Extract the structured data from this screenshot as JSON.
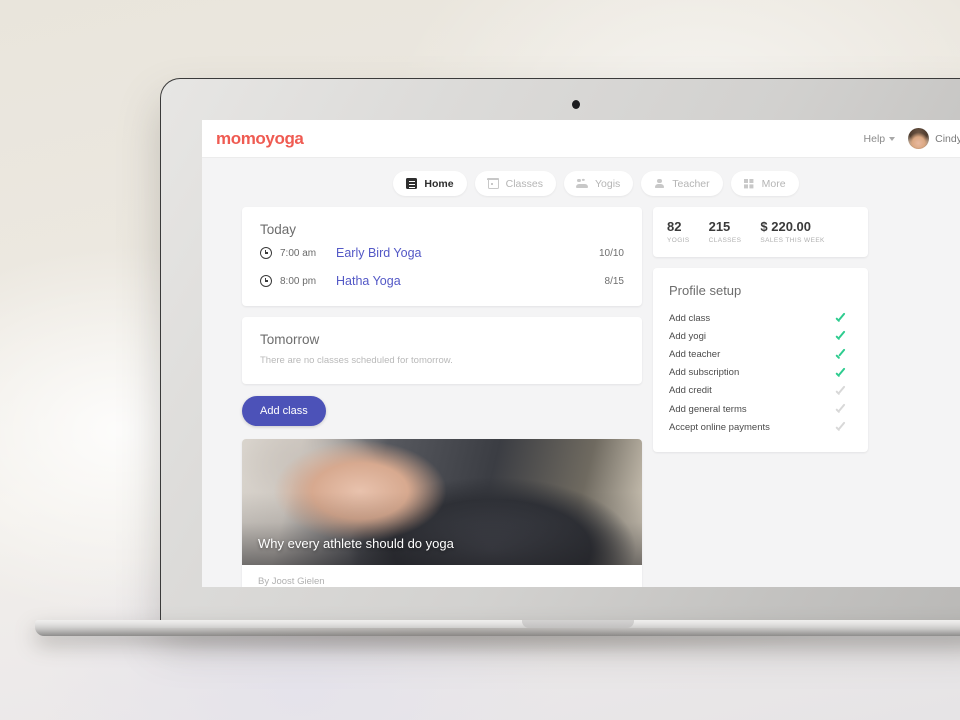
{
  "app": {
    "logo": "momoyoga",
    "help_label": "Help",
    "user_name": "Cindy"
  },
  "tabs": [
    {
      "label": "Home",
      "icon": "home-icon",
      "active": true
    },
    {
      "label": "Classes",
      "icon": "calendar-icon",
      "active": false
    },
    {
      "label": "Yogis",
      "icon": "people-icon",
      "active": false
    },
    {
      "label": "Teacher",
      "icon": "person-icon",
      "active": false
    },
    {
      "label": "More",
      "icon": "grid-icon",
      "active": false
    }
  ],
  "today": {
    "title": "Today",
    "classes": [
      {
        "time": "7:00 am",
        "name": "Early Bird Yoga",
        "count": "10/10"
      },
      {
        "time": "8:00 pm",
        "name": "Hatha Yoga",
        "count": "8/15"
      }
    ]
  },
  "tomorrow": {
    "title": "Tomorrow",
    "empty_message": "There are no classes scheduled for tomorrow."
  },
  "actions": {
    "add_class_label": "Add class"
  },
  "article": {
    "title": "Why every athlete should do yoga",
    "byline": "By Joost Gielen"
  },
  "stats": [
    {
      "value": "82",
      "label": "YOGIS"
    },
    {
      "value": "215",
      "label": "CLASSES"
    },
    {
      "value": "$ 220.00",
      "label": "SALES THIS WEEK"
    }
  ],
  "profile_setup": {
    "title": "Profile setup",
    "items": [
      {
        "label": "Add class",
        "done": true
      },
      {
        "label": "Add yogi",
        "done": true
      },
      {
        "label": "Add teacher",
        "done": true
      },
      {
        "label": "Add subscription",
        "done": true
      },
      {
        "label": "Add credit",
        "done": false
      },
      {
        "label": "Add general terms",
        "done": false
      },
      {
        "label": "Accept online payments",
        "done": false
      }
    ]
  },
  "colors": {
    "brand": "#ef5b52",
    "link": "#5358c6",
    "primary_button": "#4c52b8",
    "check_done": "#2ecc8f",
    "check_pending": "#d8d8d8",
    "page_bg": "#f4f4f5",
    "scene_bg": "#e9e5dc"
  }
}
